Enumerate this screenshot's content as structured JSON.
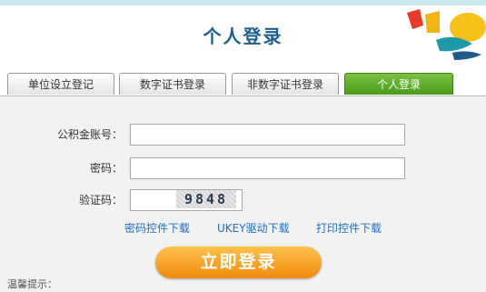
{
  "header": {
    "title": "个人登录"
  },
  "tabs": [
    {
      "label": "单位设立登记"
    },
    {
      "label": "数字证书登录"
    },
    {
      "label": "非数字证书登录"
    },
    {
      "label": "个人登录"
    }
  ],
  "active_tab": 3,
  "form": {
    "account_label": "公积金账号：",
    "account_value": "",
    "password_label": "密码：",
    "password_value": "",
    "captcha_label": "验证码：",
    "captcha_value": "",
    "captcha_text": "9848"
  },
  "links": {
    "password_control": "密码控件下载",
    "ukey_driver": "UKEY驱动下载",
    "print_control": "打印控件下载"
  },
  "login_button": "立即登录",
  "tip": "温馨提示：",
  "colors": {
    "title": "#1c5f8f",
    "active_tab": "#5aa320",
    "link": "#1f6fc4",
    "button": "#f5a020"
  }
}
